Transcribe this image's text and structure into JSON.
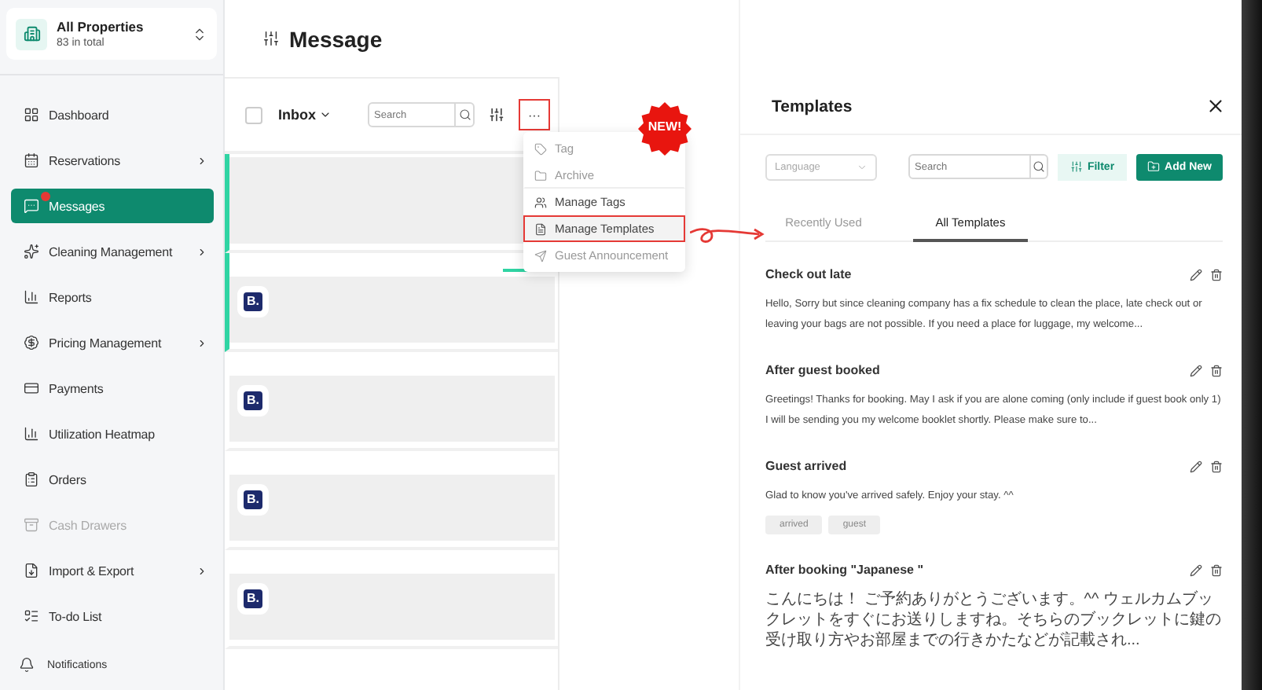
{
  "sidebar": {
    "property": {
      "name": "All Properties",
      "count": "83 in total"
    },
    "items": [
      {
        "label": "Dashboard",
        "selected": false,
        "submenu": false,
        "disabled": false,
        "unread": false
      },
      {
        "label": "Reservations",
        "selected": false,
        "submenu": true,
        "disabled": false,
        "unread": false
      },
      {
        "label": "Messages",
        "selected": true,
        "submenu": false,
        "disabled": false,
        "unread": true
      },
      {
        "label": "Cleaning Management",
        "selected": false,
        "submenu": true,
        "disabled": false,
        "unread": false
      },
      {
        "label": "Reports",
        "selected": false,
        "submenu": false,
        "disabled": false,
        "unread": false
      },
      {
        "label": "Pricing Management",
        "selected": false,
        "submenu": true,
        "disabled": false,
        "unread": false
      },
      {
        "label": "Payments",
        "selected": false,
        "submenu": false,
        "disabled": false,
        "unread": false
      },
      {
        "label": "Utilization Heatmap",
        "selected": false,
        "submenu": false,
        "disabled": false,
        "unread": false
      },
      {
        "label": "Orders",
        "selected": false,
        "submenu": false,
        "disabled": false,
        "unread": false
      },
      {
        "label": "Cash Drawers",
        "selected": false,
        "submenu": false,
        "disabled": true,
        "unread": false
      },
      {
        "label": "Import & Export",
        "selected": false,
        "submenu": true,
        "disabled": false,
        "unread": false
      },
      {
        "label": "To-do List",
        "selected": false,
        "submenu": false,
        "disabled": false,
        "unread": false
      }
    ],
    "footer": "Notifications"
  },
  "page_title": "Message",
  "inbox": {
    "select_all_checked": false,
    "folder": "Inbox",
    "search_placeholder": "Search",
    "more": "···",
    "menu": [
      {
        "label": "Tag",
        "disabled": true,
        "highlighted": false,
        "divider_after": false
      },
      {
        "label": "Archive",
        "disabled": true,
        "highlighted": false,
        "divider_after": true
      },
      {
        "label": "Manage Tags",
        "disabled": false,
        "highlighted": false,
        "divider_after": false
      },
      {
        "label": "Manage Templates",
        "disabled": false,
        "highlighted": true,
        "divider_after": false
      },
      {
        "label": "Guest Announcement",
        "disabled": true,
        "highlighted": false,
        "divider_after": false
      }
    ],
    "new_badge": "NEW!",
    "conversations": [
      {
        "selected": true,
        "tagged": false
      },
      {
        "selected": true,
        "logo": "B.",
        "tagged": true
      },
      {
        "selected": false,
        "logo": "B.",
        "tagged": false
      },
      {
        "selected": false,
        "logo": "B.",
        "tagged": false
      },
      {
        "selected": false,
        "logo": "B.",
        "tagged": false
      }
    ]
  },
  "templates": {
    "title": "Templates",
    "language_placeholder": "Language",
    "search_placeholder": "Search",
    "filter": "Filter",
    "add_new": "Add New",
    "tabs": [
      {
        "label": "Recently Used",
        "selected": false
      },
      {
        "label": "All Templates",
        "selected": true
      }
    ],
    "items": [
      {
        "title": "Check out late",
        "body": "Hello, Sorry but since cleaning company has a fix schedule to clean the place, late check out or leaving your bags are not possible. If you need a place for luggage, my welcome..."
      },
      {
        "title": "After guest booked",
        "body": "Greetings! Thanks for booking. May I ask if you are alone coming (only include if guest book only 1) I will be sending you my welcome booklet shortly. Please make sure to..."
      },
      {
        "title": "Guest arrived",
        "body": "Glad to know you've arrived safely. Enjoy your stay. ^^",
        "tags": [
          "arrived",
          "guest"
        ]
      },
      {
        "title": "After booking \"Japanese \"",
        "body": "こんにちは！ ご予約ありがとうございます。^^ ウェルカムブックレットをすぐにお送りしますね。そちらのブックレットに鍵の受け取り方やお部屋までの行きかたなどが記載され..."
      }
    ]
  }
}
